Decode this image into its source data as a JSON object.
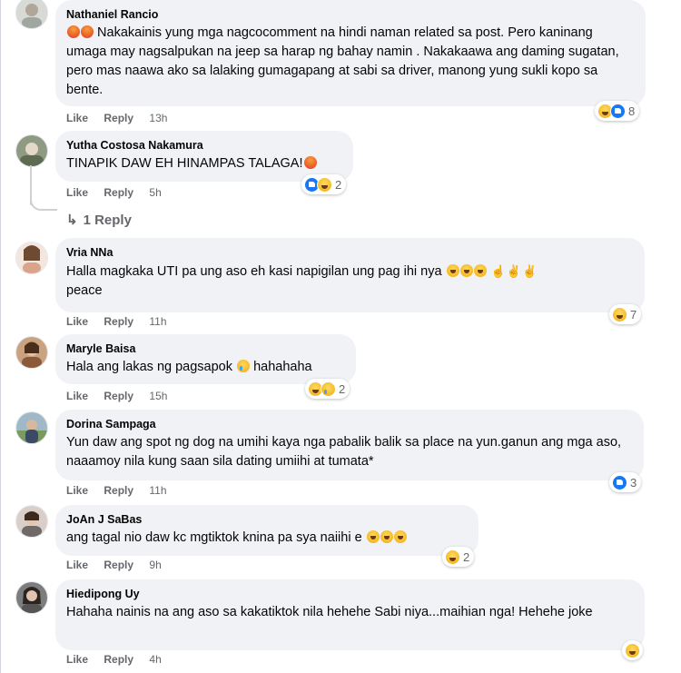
{
  "action_labels": {
    "like": "Like",
    "reply": "Reply"
  },
  "comments": [
    {
      "author": "Nathaniel Rancio",
      "text": "Nakakainis yung mga nagcocomment na hindi naman related sa post. Pero kaninang umaga may nagsalpukan na jeep sa harap ng bahay namin . Nakakaawa ang daming sugatan, pero mas naawa ako sa lalaking gumagapang at sabi sa driver, manong yung sukli kopo sa bente.",
      "time": "13h",
      "reaction_count": "8",
      "avatar_color": "#c7c9c4"
    },
    {
      "author": "Yutha Costosa Nakamura",
      "text": "TINAPIK DAW EH HINAMPAS TALAGA!",
      "time": "5h",
      "reaction_count": "2",
      "replies_label": "1 Reply",
      "avatar_color": "#7f8a6e"
    },
    {
      "author": "Vria NNa",
      "text_line1": "Halla magkaka UTI pa ung aso eh kasi napigilan ung pag ihi nya",
      "text_line2": "peace",
      "time": "11h",
      "reaction_count": "7",
      "avatar_color": "#e3b8a1"
    },
    {
      "author": "Maryle Baisa",
      "text": "Hala ang lakas ng pagsapok",
      "text_after": "hahahaha",
      "time": "15h",
      "reaction_count": "2",
      "avatar_color": "#b9916a"
    },
    {
      "author": "Dorina Sampaga",
      "text": "Yun daw ang spot ng dog na umihi kaya nga pabalik balik sa place na yun.ganun ang mga aso, naaamoy nila kung saan sila dating umiihi at tumata*",
      "time": "11h",
      "reaction_count": "3",
      "avatar_color": "#8aa6b8"
    },
    {
      "author": "JoAn J SaBas",
      "text": "ang tagal nio daw kc mgtiktok knina pa sya naiihi e",
      "time": "9h",
      "reaction_count": "2",
      "avatar_color": "#b5a7a0"
    },
    {
      "author": "Hiedipong Uy",
      "text": "Hahaha nainis na ang aso sa kakatiktok nila hehehe Sabi niya...maihian nga! Hehehe joke",
      "time": "4h",
      "avatar_color": "#8b8b8b"
    }
  ]
}
